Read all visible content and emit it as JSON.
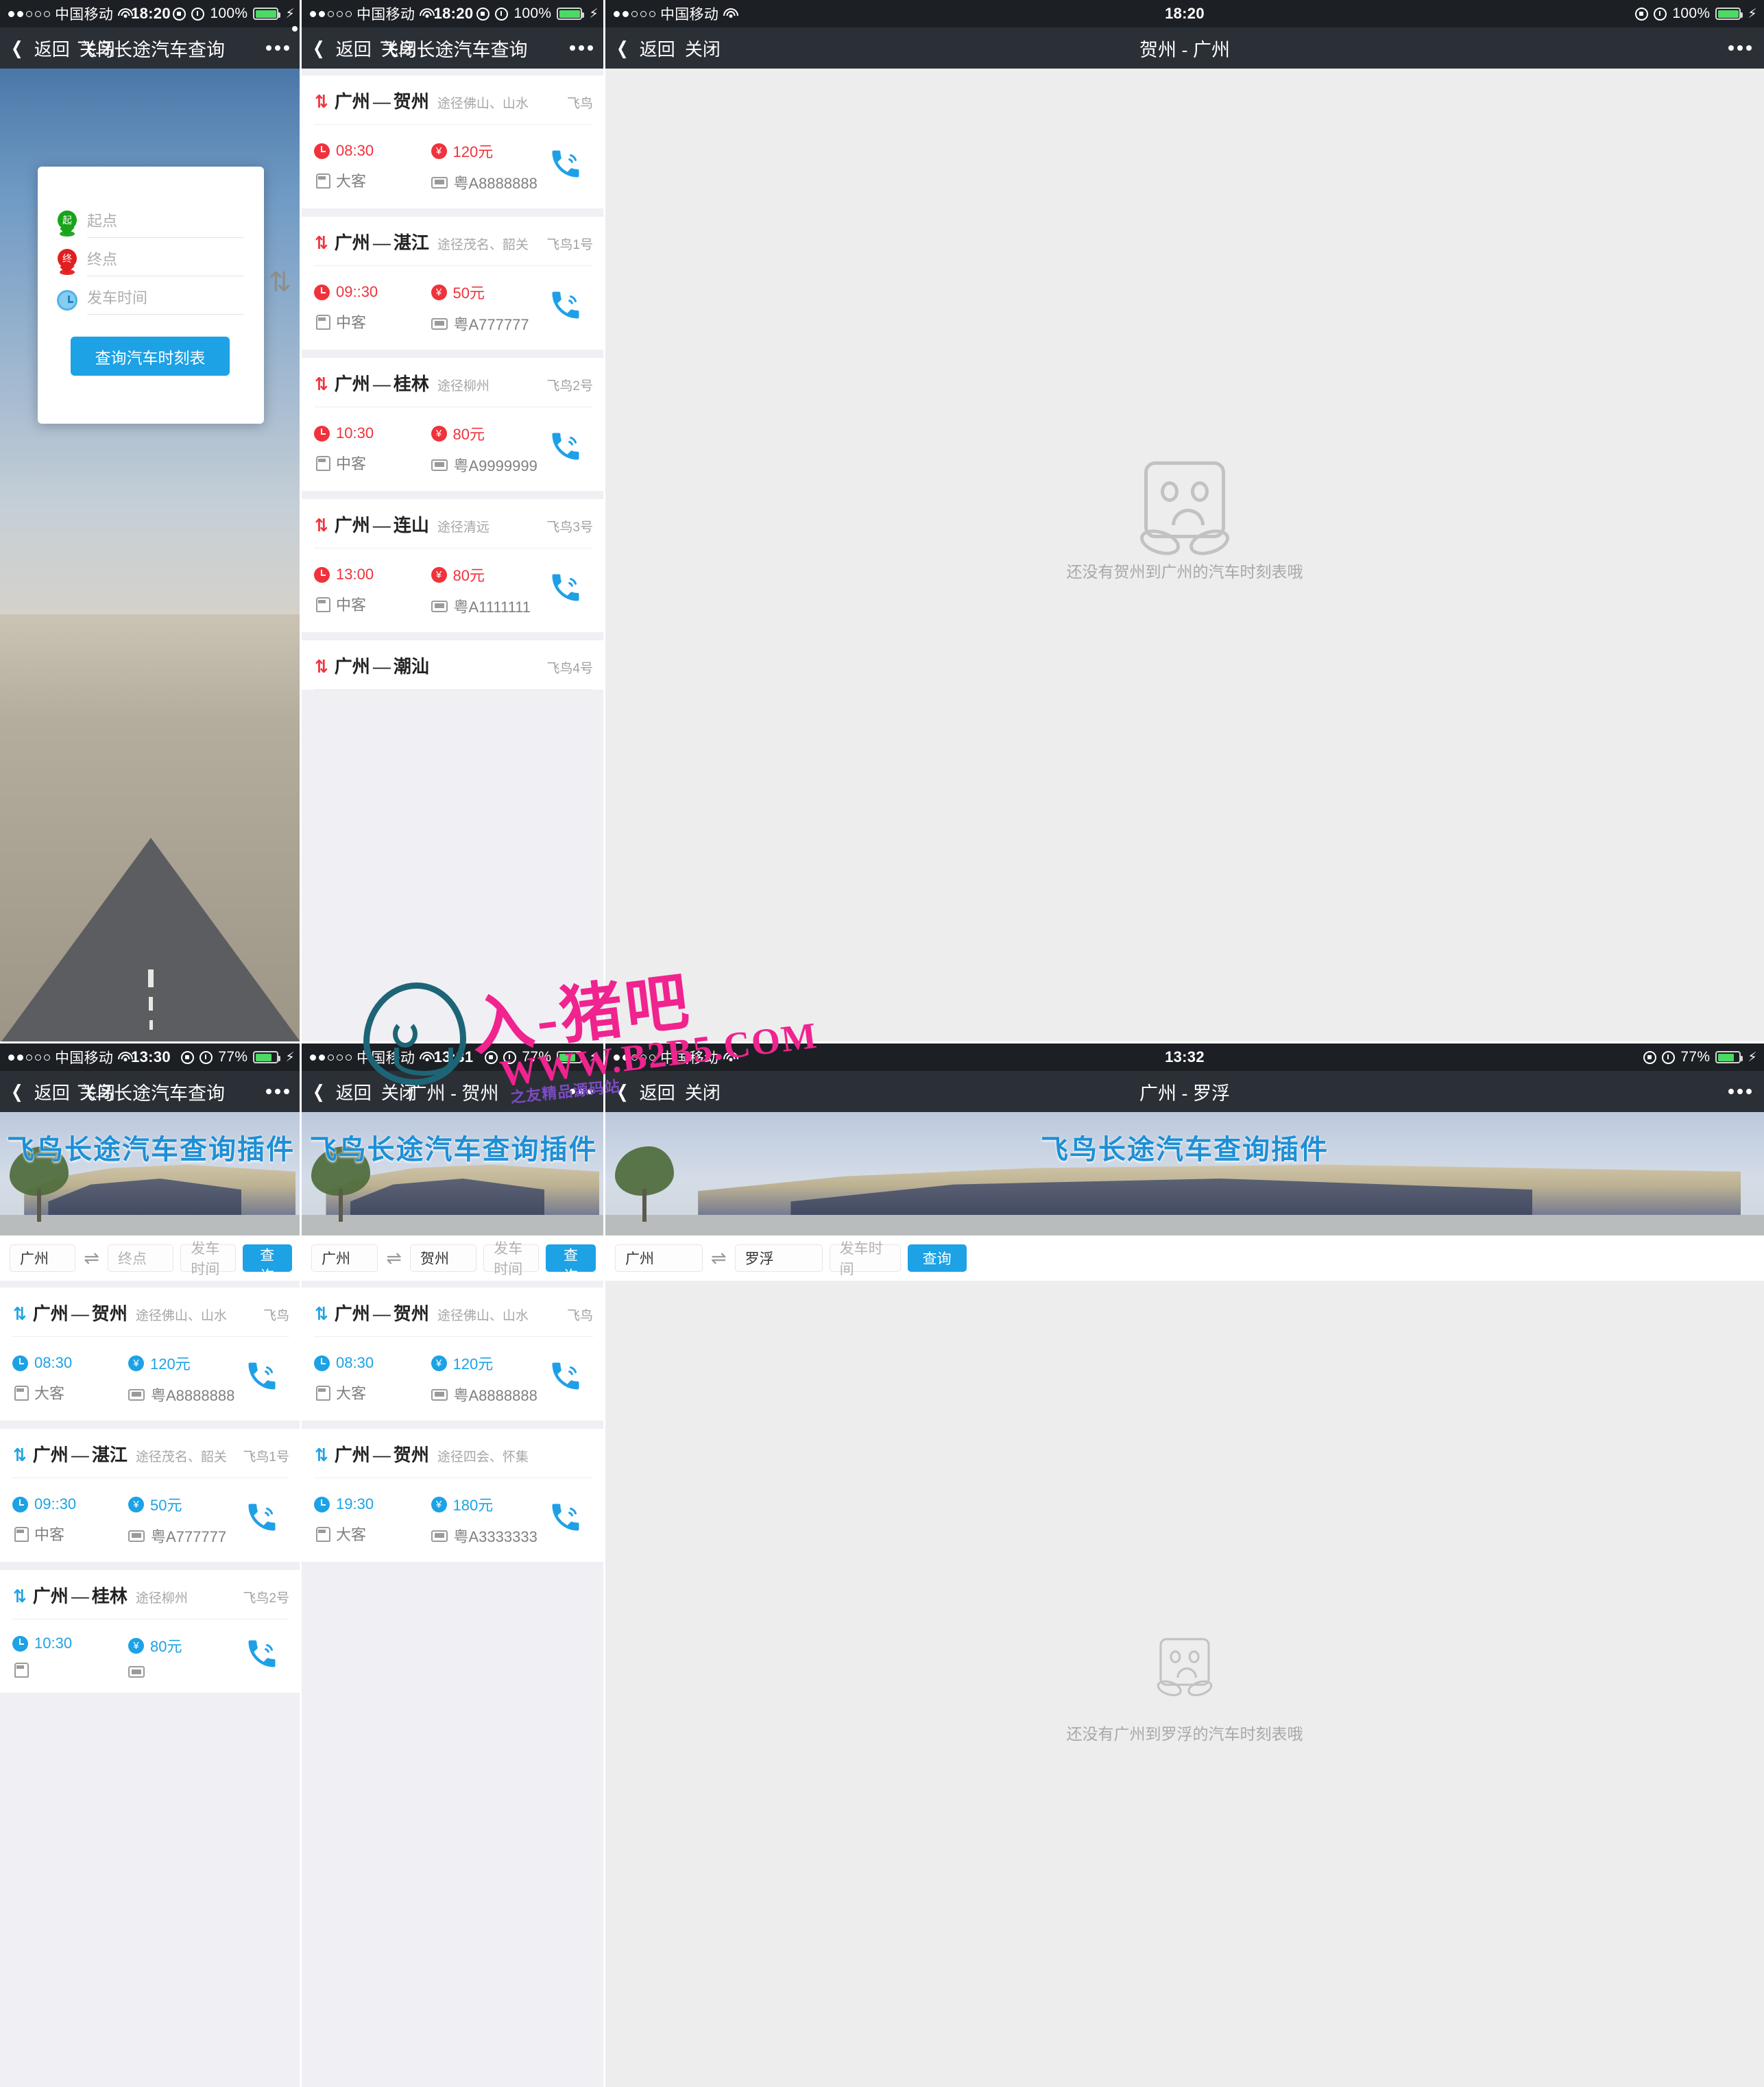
{
  "statusbar_top": {
    "carrier": "中国移动",
    "time": "18:20",
    "battery_pct": "100%",
    "wifi_icon": "wifi-icon",
    "lock_icon": "rotation-lock-icon",
    "alarm_icon": "alarm-icon",
    "bolt_icon": "charging-bolt-icon"
  },
  "statusbar_bottom_left": {
    "carrier": "中国移动",
    "time": "13:30",
    "battery_pct": "77%"
  },
  "statusbar_bottom_mid": {
    "carrier": "中国移动",
    "time": "13:31",
    "battery_pct": "77%"
  },
  "statusbar_bottom_right": {
    "carrier": "中国移动",
    "time": "13:32",
    "battery_pct": "77%"
  },
  "nav": {
    "back": "返回",
    "close": "关闭",
    "more_icon": "more-options-icon",
    "back_icon": "chevron-left-icon"
  },
  "titles": {
    "app": "飞鸟长途汽车查询",
    "hezhou_guangzhou": "贺州 - 广州",
    "guangzhou_hezhou": "广州 - 贺州",
    "guangzhou_luofu": "广州 - 罗浮"
  },
  "form": {
    "start_placeholder": "起点",
    "end_placeholder": "终点",
    "time_placeholder": "发车时间",
    "submit_label": "查询汽车时刻表",
    "start_pin_label": "起",
    "end_pin_label": "终",
    "swap_icon": "swap-vertical-icon",
    "clock_icon": "clock-icon"
  },
  "searchbar": {
    "time_placeholder": "发车时间",
    "end_placeholder": "终点",
    "query_label": "查询",
    "swap_icon": "swap-horizontal-icon",
    "panel_left": {
      "from": "广州",
      "to": ""
    },
    "panel_mid": {
      "from": "广州",
      "to": "贺州"
    },
    "panel_right": {
      "from": "广州",
      "to": "罗浮"
    }
  },
  "banner": {
    "title": "飞鸟长途汽车查询插件"
  },
  "empty_state": {
    "icon": "sad-face-icon",
    "hezhou_guangzhou": "还没有贺州到广州的汽车时刻表哦",
    "guangzhou_luofu": "还没有广州到罗浮的汽车时刻表哦"
  },
  "icons": {
    "wave": "↑↓",
    "arrow": "—",
    "phone": "📞",
    "clock": "clock-icon",
    "yuan": "¥",
    "bus": "bus-icon",
    "plate": "license-plate-icon"
  },
  "list_red": [
    {
      "from": "广州",
      "to": "贺州",
      "via": "途径佛山、山水",
      "brand": "飞鸟",
      "time": "08:30",
      "price": "120元",
      "bus_type": "大客",
      "plate": "粤A8888888"
    },
    {
      "from": "广州",
      "to": "湛江",
      "via": "途径茂名、韶关",
      "brand": "飞鸟1号",
      "time": "09::30",
      "price": "50元",
      "bus_type": "中客",
      "plate": "粤A777777"
    },
    {
      "from": "广州",
      "to": "桂林",
      "via": "途径柳州",
      "brand": "飞鸟2号",
      "time": "10:30",
      "price": "80元",
      "bus_type": "中客",
      "plate": "粤A9999999"
    },
    {
      "from": "广州",
      "to": "连山",
      "via": "途径清远",
      "brand": "飞鸟3号",
      "time": "13:00",
      "price": "80元",
      "bus_type": "中客",
      "plate": "粤A1111111"
    },
    {
      "from": "广州",
      "to": "潮汕",
      "via": "",
      "brand": "飞鸟4号",
      "time": "",
      "price": "",
      "bus_type": "",
      "plate": ""
    }
  ],
  "list_blue_left": [
    {
      "from": "广州",
      "to": "贺州",
      "via": "途径佛山、山水",
      "brand": "飞鸟",
      "time": "08:30",
      "price": "120元",
      "bus_type": "大客",
      "plate": "粤A8888888"
    },
    {
      "from": "广州",
      "to": "湛江",
      "via": "途径茂名、韶关",
      "brand": "飞鸟1号",
      "time": "09::30",
      "price": "50元",
      "bus_type": "中客",
      "plate": "粤A777777"
    },
    {
      "from": "广州",
      "to": "桂林",
      "via": "途径柳州",
      "brand": "飞鸟2号",
      "time": "10:30",
      "price": "80元",
      "bus_type": "",
      "plate": ""
    }
  ],
  "list_blue_mid": [
    {
      "from": "广州",
      "to": "贺州",
      "via": "途径佛山、山水",
      "brand": "飞鸟",
      "time": "08:30",
      "price": "120元",
      "bus_type": "大客",
      "plate": "粤A8888888"
    },
    {
      "from": "广州",
      "to": "贺州",
      "via": "途径四会、怀集",
      "brand": "",
      "time": "19:30",
      "price": "180元",
      "bus_type": "大客",
      "plate": "粤A3333333"
    }
  ],
  "watermark": {
    "line1": "入-猪吧",
    "line2": "WWW.B2B5.COM",
    "line3": "之友精品源码站"
  },
  "colors": {
    "accent_blue": "#1ca2e5",
    "accent_red": "#f0323c",
    "nav_bg": "#2b2f36",
    "page_bg": "#efeff4"
  }
}
